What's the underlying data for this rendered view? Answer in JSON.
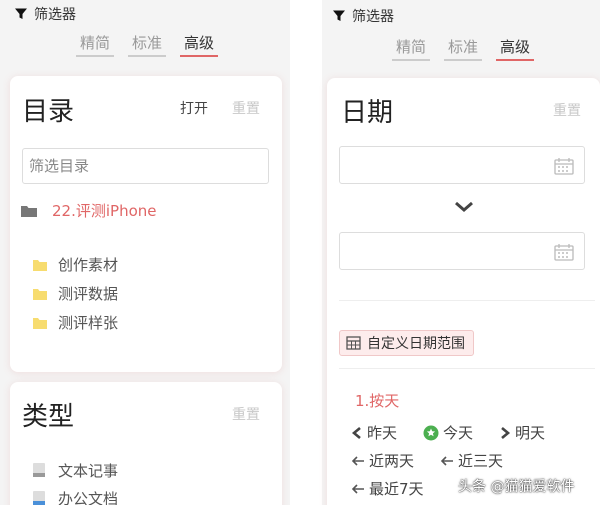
{
  "left": {
    "filter_title": "筛选器",
    "tabs": [
      "精简",
      "标准",
      "高级"
    ],
    "catalog": {
      "title": "目录",
      "open": "打开",
      "reset": "重置",
      "filter_placeholder": "筛选目录",
      "root_folder": "22.评测iPhone",
      "folders": [
        "创作素材",
        "测评数据",
        "测评样张"
      ]
    },
    "types": {
      "title": "类型",
      "reset": "重置",
      "items": [
        "文本记事",
        "办公文档"
      ]
    }
  },
  "right": {
    "filter_title": "筛选器",
    "tabs": [
      "精简",
      "标准",
      "高级"
    ],
    "date": {
      "title": "日期",
      "reset": "重置",
      "custom_range": "自定义日期范围",
      "by_day": "1.按天",
      "yesterday": "昨天",
      "today": "今天",
      "tomorrow": "明天",
      "last_two_days": "近两天",
      "last_three_days": "近三天",
      "last_seven_days": "最近7天"
    }
  },
  "watermark": "头条 @猫猫爱软件",
  "colors": {
    "accent": "#e06666",
    "folder_yellow": "#f7dc6f",
    "panel_bg": "#f4f4f4",
    "green_today": "#4caf50"
  }
}
